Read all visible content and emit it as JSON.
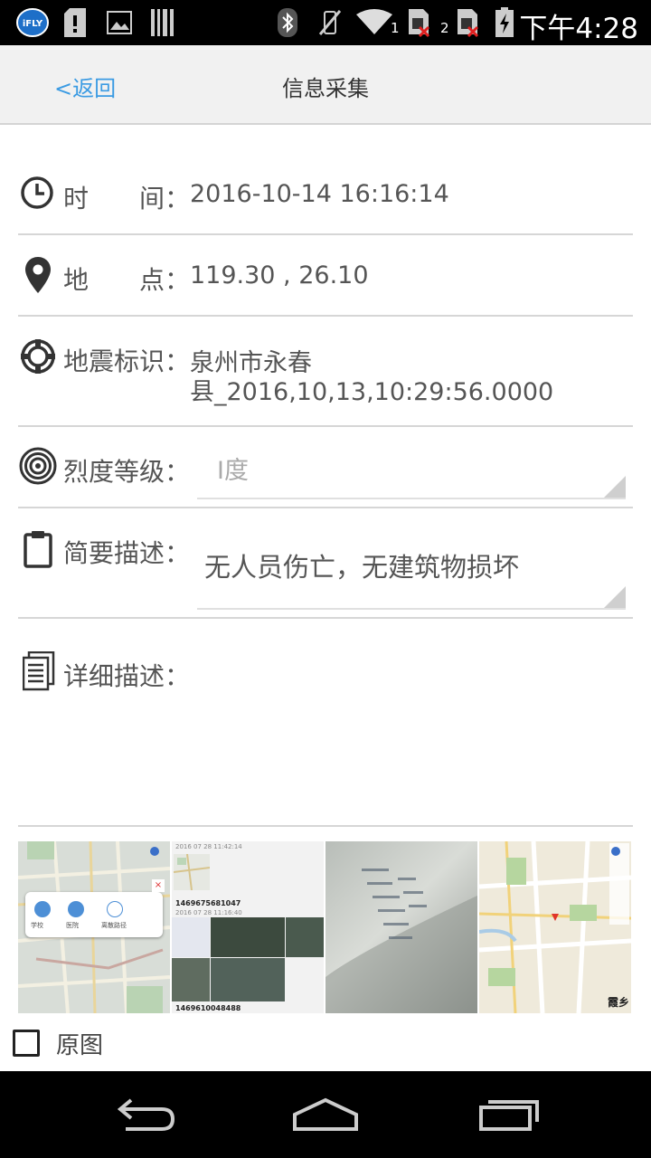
{
  "status_bar": {
    "time": "下午4:28",
    "sim1_label": "1",
    "sim2_label": "2",
    "app_icon_text": "iFLY",
    "icons": [
      "ifly-app-icon",
      "sd-card-icon",
      "image-icon",
      "barcode-icon",
      "bluetooth-icon",
      "vibrate-off-icon",
      "wifi-icon",
      "sim1-no-service-icon",
      "sim2-no-service-icon",
      "battery-charging-icon"
    ]
  },
  "navbar": {
    "back_label": "<返回",
    "title": "信息采集"
  },
  "form": {
    "time": {
      "label_a": "时",
      "label_b": "间：",
      "value": "2016-10-14  16:16:14",
      "icon": "clock-icon"
    },
    "location": {
      "label_a": "地",
      "label_b": "点：",
      "value": "119.30 , 26.10",
      "icon": "location-pin-icon"
    },
    "quake_id": {
      "label": "地震标识：",
      "value_line1": "泉州市永春",
      "value_line2": "县_2016,10,13,10:29:56.0000",
      "icon": "crosshair-icon"
    },
    "intensity": {
      "label": "烈度等级：",
      "value": "Ⅰ度",
      "icon": "concentric-circles-icon"
    },
    "brief": {
      "label": "简要描述：",
      "value": "无人员伤亡，无建筑物损坏",
      "icon": "clipboard-icon"
    },
    "detail": {
      "label": "详细描述：",
      "value": "",
      "icon": "document-icon"
    }
  },
  "thumbnails": {
    "t1": {
      "popup_labels": [
        "学校",
        "医院",
        "离散路径"
      ],
      "kind": "map-screenshot"
    },
    "t2": {
      "date1": "2016 07 28 11:42:14",
      "id1": "1469675681047",
      "date2": "2016 07 28 11:16:40",
      "id2": "1469610048488",
      "kind": "gallery-screenshot"
    },
    "t3": {
      "kind": "photo-of-screen"
    },
    "t4": {
      "corner_text": "霞乡",
      "kind": "map-screenshot"
    }
  },
  "original_image": {
    "label": "原图",
    "checked": false
  },
  "colors": {
    "accent": "#3b9be3",
    "status_bar": "#000000",
    "nav_bg": "#f1f1f1",
    "divider": "#d6d6d6",
    "text": "#555555"
  }
}
